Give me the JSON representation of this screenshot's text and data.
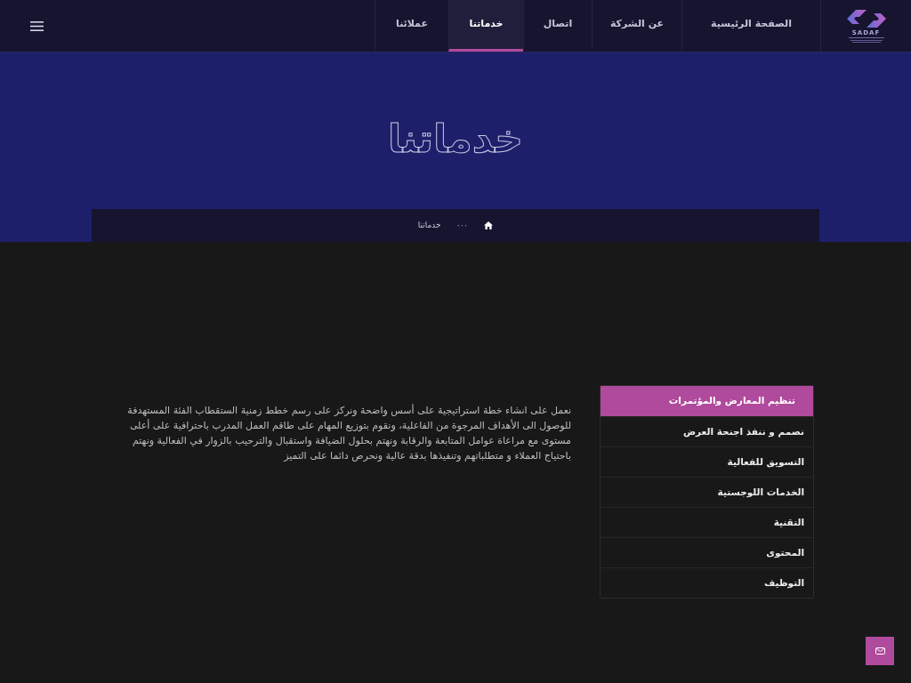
{
  "header": {
    "logo": {
      "text": "SADAF"
    },
    "nav": [
      {
        "label": "الصفحة الرئيسية",
        "selected": false
      },
      {
        "label": "عن الشركة",
        "selected": false
      },
      {
        "label": "اتصال",
        "selected": false
      },
      {
        "label": "خدماتنا",
        "selected": true
      },
      {
        "label": "عملائنا",
        "selected": false
      }
    ]
  },
  "hero": {
    "title": "خدماتنا"
  },
  "breadcrumb": [
    {
      "kind": "home"
    },
    {
      "kind": "ellipsis",
      "label": "···"
    },
    {
      "kind": "page",
      "label": "خدماتنا"
    }
  ],
  "description": "نعمل على انشاء خطة استراتيجية على أسس واضحة ونركز على رسم خطط زمنية الستقطاب الفئة المستهدفة للوصول الى الأهداف المرجوة من الفاعلية، ونقوم بتوزيع المهام على طاقم العمل المدرب باحترافية على أعلى مستوى مع مراعاة عوامل المتابعة والرقابة ونهتم بحلول الضيافة واستقبال والترحيب بالزوار في الفعالية ونهتم باحتياج العملاء و متطلباتهم وتنفيذها بدقة عالية ونحرص دائما على التميز",
  "services": [
    {
      "label": "تنظيم المعارض والمؤتمرات",
      "selected": true
    },
    {
      "label": "نصمم و ننفذ اجنحة العرض",
      "selected": false
    },
    {
      "label": "التسويق للفعالية",
      "selected": false
    },
    {
      "label": "الخدمات اللوجستية",
      "selected": false
    },
    {
      "label": "التقنية",
      "selected": false
    },
    {
      "label": "المحتوى",
      "selected": false
    },
    {
      "label": "التوظيف",
      "selected": false
    }
  ]
}
